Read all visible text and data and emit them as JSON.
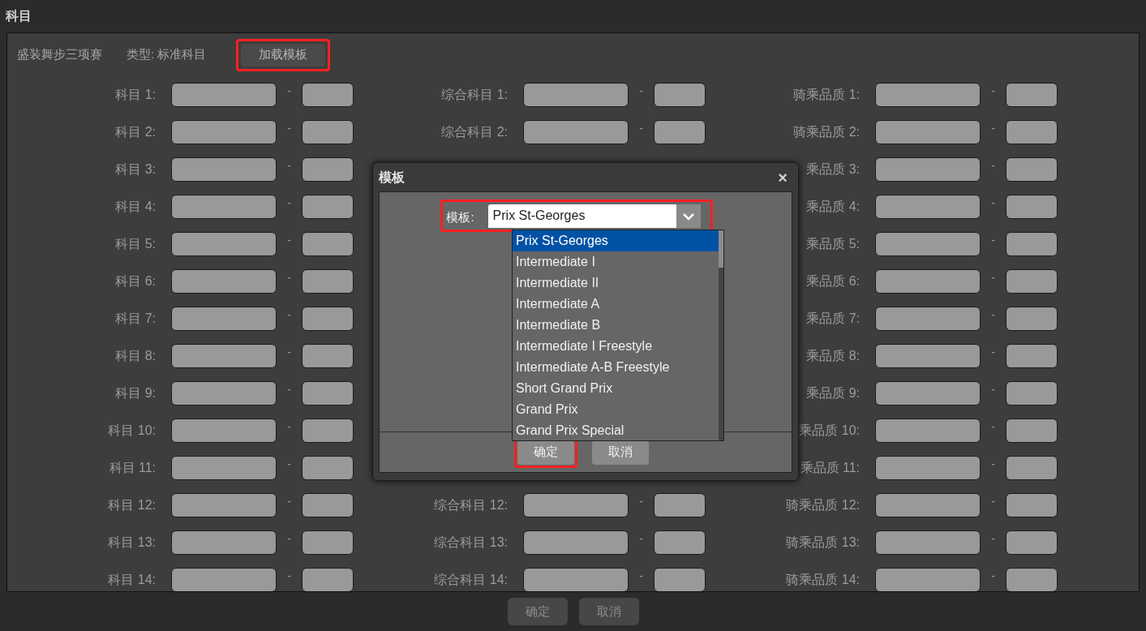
{
  "window": {
    "title": "科目"
  },
  "header": {
    "event_name": "盛装舞步三项赛",
    "type_text": "类型: 标准科目",
    "load_button": {
      "label": "加载模板",
      "highlighted": true
    }
  },
  "columns": [
    {
      "rows": [
        {
          "label": "科目 1:",
          "separator": "-"
        },
        {
          "label": "科目 2:",
          "separator": "-"
        },
        {
          "label": "科目 3:",
          "separator": "-"
        },
        {
          "label": "科目 4:",
          "separator": "-"
        },
        {
          "label": "科目 5:",
          "separator": "-"
        },
        {
          "label": "科目 6:",
          "separator": "-"
        },
        {
          "label": "科目 7:",
          "separator": "-"
        },
        {
          "label": "科目 8:",
          "separator": "-"
        },
        {
          "label": "科目 9:",
          "separator": "-"
        },
        {
          "label": "科目 10:",
          "separator": "-"
        },
        {
          "label": "科目 11:",
          "separator": "-"
        },
        {
          "label": "科目 12:",
          "separator": "-"
        },
        {
          "label": "科目 13:",
          "separator": "-"
        },
        {
          "label": "科目 14:",
          "separator": "-"
        }
      ]
    },
    {
      "rows_top": [
        {
          "label": "综合科目 1:",
          "separator": "-"
        },
        {
          "label": "综合科目 2:",
          "separator": "-"
        }
      ],
      "rows_bottom": [
        {
          "label": "综合科目 12:",
          "separator": "-"
        },
        {
          "label": "综合科目 13:",
          "separator": "-"
        },
        {
          "label": "综合科目 14:",
          "separator": "-"
        }
      ]
    },
    {
      "rows": [
        {
          "label": "骑乘品质 1:",
          "separator": "-"
        },
        {
          "label": "骑乘品质 2:",
          "separator": "-"
        },
        {
          "label": "乘品质 3:",
          "separator": "-"
        },
        {
          "label": "乘品质 4:",
          "separator": "-"
        },
        {
          "label": "乘品质 5:",
          "separator": "-"
        },
        {
          "label": "乘品质 6:",
          "separator": "-"
        },
        {
          "label": "乘品质 7:",
          "separator": "-"
        },
        {
          "label": "乘品质 8:",
          "separator": "-"
        },
        {
          "label": "乘品质 9:",
          "separator": "-"
        },
        {
          "label": "乘品质 10:",
          "separator": "-"
        },
        {
          "label": "乘品质 11:",
          "separator": "-"
        },
        {
          "label": "骑乘品质 12:",
          "separator": "-"
        },
        {
          "label": "骑乘品质 13:",
          "separator": "-"
        },
        {
          "label": "骑乘品质 14:",
          "separator": "-"
        }
      ]
    }
  ],
  "footer_buttons": [
    {
      "label": "确定"
    },
    {
      "label": "取消"
    }
  ],
  "dialog": {
    "title": "模板",
    "close": "×",
    "template_field": {
      "label": "模板:",
      "value": "Prix St-Georges",
      "highlighted": true
    },
    "options": [
      {
        "label": "Prix St-Georges",
        "selected": true
      },
      {
        "label": "Intermediate I",
        "selected": false
      },
      {
        "label": "Intermediate II",
        "selected": false
      },
      {
        "label": "Intermediate A",
        "selected": false
      },
      {
        "label": "Intermediate B",
        "selected": false
      },
      {
        "label": "Intermediate I Freestyle",
        "selected": false
      },
      {
        "label": "Intermediate A-B Freestyle",
        "selected": false
      },
      {
        "label": "Short Grand Prix",
        "selected": false
      },
      {
        "label": "Grand Prix",
        "selected": false
      },
      {
        "label": "Grand Prix Special",
        "selected": false
      }
    ],
    "buttons": [
      {
        "label": "确定",
        "highlighted": true
      },
      {
        "label": "取消",
        "highlighted": false
      }
    ]
  }
}
